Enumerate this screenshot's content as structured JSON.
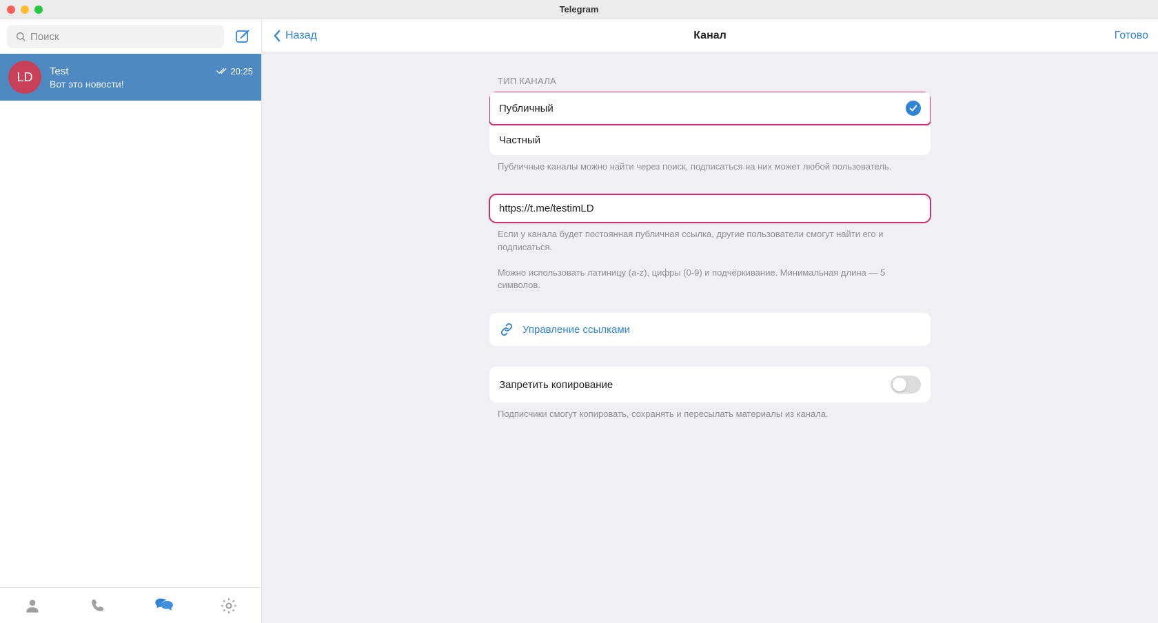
{
  "window": {
    "title": "Telegram"
  },
  "sidebar": {
    "search_placeholder": "Поиск",
    "chat": {
      "avatar_initials": "LD",
      "name": "Test",
      "preview": "Вот это новости!",
      "time": "20:25"
    }
  },
  "header": {
    "back_label": "Назад",
    "title": "Канал",
    "done_label": "Готово"
  },
  "type_section": {
    "label": "ТИП КАНАЛА",
    "public_label": "Публичный",
    "private_label": "Частный",
    "hint": "Публичные каналы можно найти через поиск, подписаться на них может любой пользователь."
  },
  "link_section": {
    "value": "https://t.me/testimLD",
    "hint1": "Если у канала будет постоянная публичная ссылка, другие пользователи смогут найти его и подписаться.",
    "hint2": "Можно использовать латиницу (a-z), цифры (0-9) и подчёркивание. Минимальная длина — 5 символов."
  },
  "manage_links": {
    "label": "Управление ссылками"
  },
  "restrict_copy": {
    "label": "Запретить копирование",
    "hint": "Подписчики смогут копировать, сохранять и пересылать материалы из канала."
  }
}
